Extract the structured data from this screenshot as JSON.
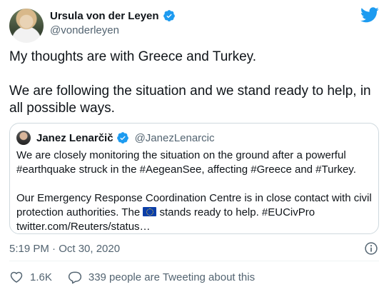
{
  "author": {
    "display_name": "Ursula von der Leyen",
    "handle": "@vonderleyen"
  },
  "tweet": {
    "paragraphs": [
      "My thoughts are with Greece and Turkey.",
      "We are following the situation and we stand ready to help, in all possible ways."
    ]
  },
  "quoted_tweet": {
    "display_name": "Janez Lenarčič",
    "handle": "@JanezLenarcic",
    "paragraph_1": "We are closely monitoring the situation on the ground after a powerful #earthquake struck in the #AegeanSee, affecting #Greece and #Turkey.",
    "paragraph_2_before_flag": "Our Emergency Response Coordination Centre is in close contact with civil protection authorities. The ",
    "paragraph_2_after_flag": " stands ready to help. #EUCivPro twitter.com/Reuters/status…"
  },
  "timestamp": "5:19 PM · Oct 30, 2020",
  "actions": {
    "like_count": "1.6K",
    "reply_label": "339 people are Tweeting about this"
  },
  "colors": {
    "verified": "#1d9bf0",
    "twitter_brand": "#1d9bf0",
    "muted_text": "#536471",
    "border": "#cfd9de"
  },
  "icons": [
    "verified-badge-icon",
    "twitter-bird-icon",
    "info-icon",
    "heart-icon",
    "comment-icon",
    "eu-flag-icon"
  ]
}
